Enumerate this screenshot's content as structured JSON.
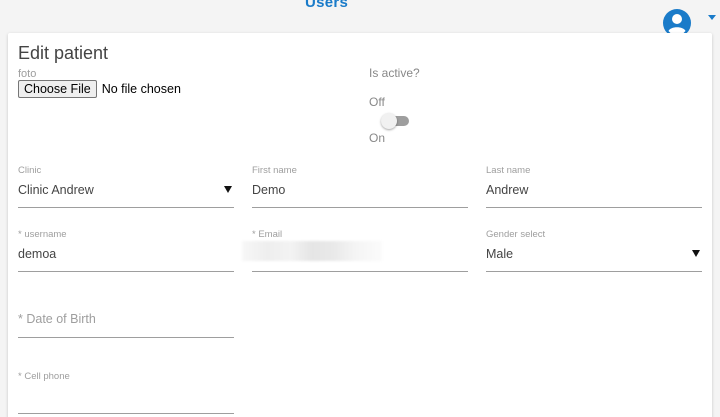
{
  "header": {
    "title": "Users",
    "brand_color": "#1a7bc9"
  },
  "icons": {
    "account": "account-circle-icon",
    "menu_caret": "caret-down-icon"
  },
  "form": {
    "title": "Edit patient",
    "foto": {
      "label": "foto",
      "button_label": "Choose File",
      "status": "No file chosen"
    },
    "active": {
      "label": "Is active?",
      "off_label": "Off",
      "on_label": "On",
      "checked": false
    },
    "fields": {
      "clinic": {
        "label": "Clinic",
        "value": "Clinic Andrew"
      },
      "first_name": {
        "label": "First name",
        "value": "Demo"
      },
      "last_name": {
        "label": "Last name",
        "value": "Andrew"
      },
      "username": {
        "label": "* username",
        "value": "demoa"
      },
      "email": {
        "label": "* Email",
        "value": ""
      },
      "gender": {
        "label": "Gender select",
        "value": "Male"
      },
      "dob": {
        "placeholder": "* Date of Birth"
      },
      "cell_phone": {
        "label": "* Cell phone",
        "value": ""
      }
    }
  }
}
